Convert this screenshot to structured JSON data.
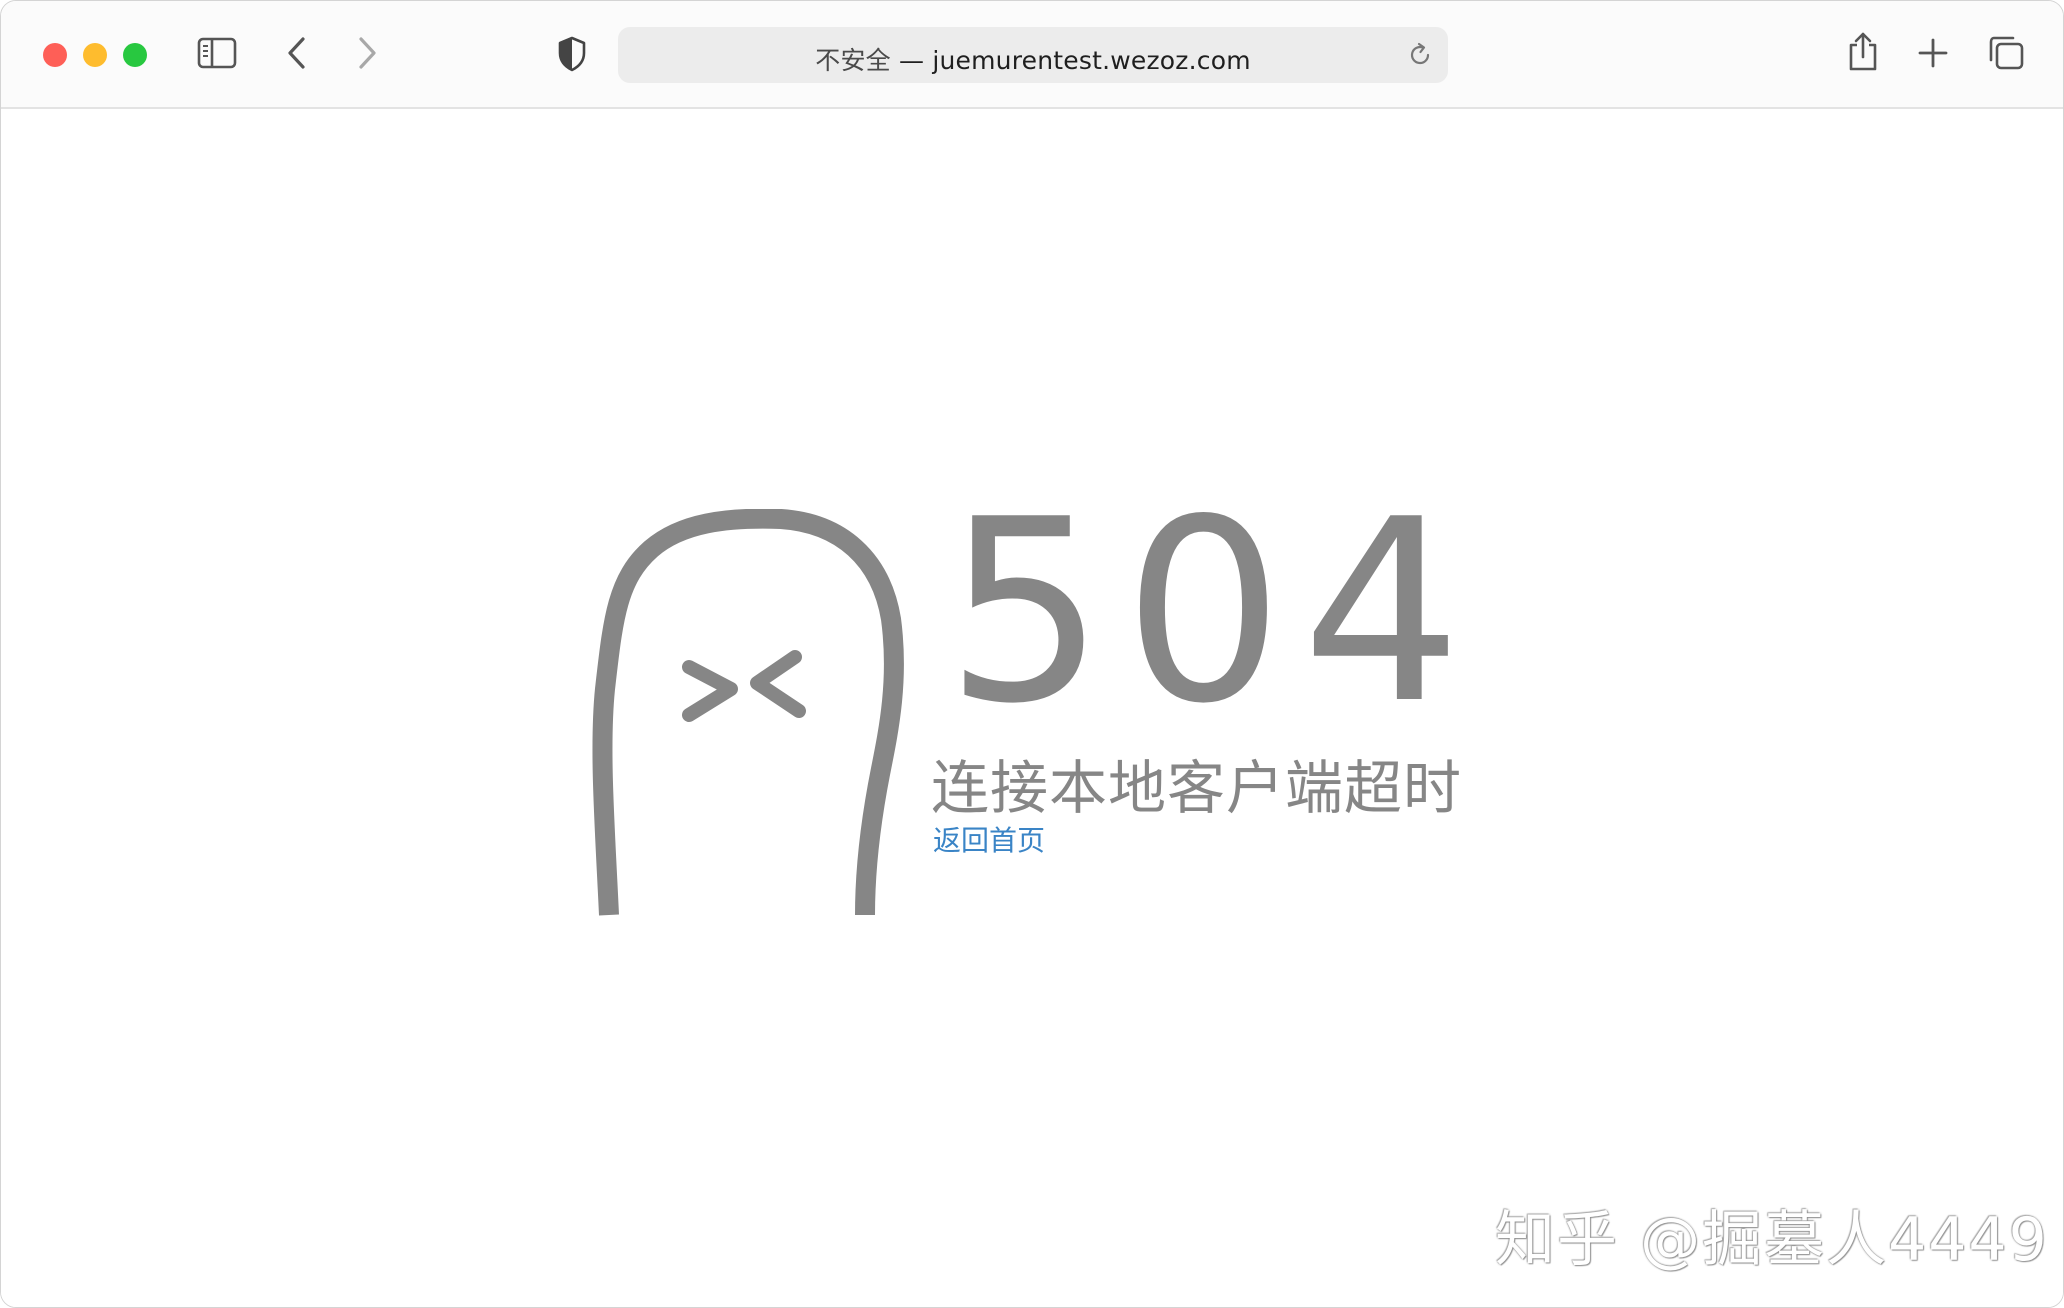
{
  "window": {
    "traffic_lights": {
      "close_color": "#fe5f57",
      "minimize_color": "#febc2e",
      "zoom_color": "#28c840"
    }
  },
  "toolbar": {
    "sidebar_icon": "sidebar-icon",
    "back_icon": "chevron-left-icon",
    "forward_icon": "chevron-right-icon",
    "privacy_icon": "shield-icon",
    "share_icon": "share-icon",
    "new_tab_icon": "plus-icon",
    "tabs_overview_icon": "tabs-icon"
  },
  "address_bar": {
    "security_label": "不安全",
    "separator": " — ",
    "domain": "juemurentest.wezoz.com",
    "reload_icon": "reload-icon"
  },
  "page": {
    "error_code": "504",
    "error_message": "连接本地客户端超时",
    "home_link": "返回首页",
    "text_color": "#868686",
    "link_color": "#3a84c6"
  },
  "watermark": {
    "text": "知乎 @掘墓人4449"
  }
}
